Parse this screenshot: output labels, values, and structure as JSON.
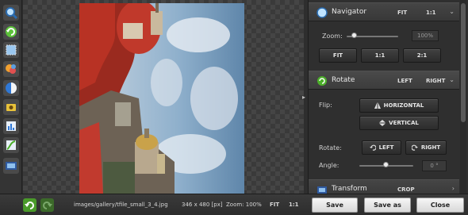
{
  "toolbar": {
    "tools": [
      "zoom-icon",
      "rotate-icon",
      "crop-icon",
      "effects-icon",
      "color-icon",
      "light-icon",
      "levels-icon",
      "curves-icon",
      "resize-icon"
    ]
  },
  "canvas": {
    "image_name": "cathedral-tilted-photo"
  },
  "navigator": {
    "title": "Navigator",
    "fit_label": "FIT",
    "one_to_one_label": "1:1",
    "zoom_label": "Zoom:",
    "zoom_value": "100%",
    "zoom_level": 0.15,
    "buttons": [
      "FIT",
      "1:1",
      "2:1"
    ]
  },
  "rotate": {
    "title": "Rotate",
    "left_label": "LEFT",
    "right_label": "RIGHT",
    "flip_label": "Flip:",
    "flip_horizontal": "HORIZONTAL",
    "flip_vertical": "VERTICAL",
    "rotate_label": "Rotate:",
    "rotate_left": "LEFT",
    "rotate_right": "RIGHT",
    "angle_label": "Angle:",
    "angle_value": "0 °",
    "angle_level": 0.5
  },
  "transform": {
    "title": "Transform",
    "crop_label": "CROP"
  },
  "status": {
    "file_path": "images/gallery/tfile_small_3_4.jpg",
    "dimensions": "346 x 480 [px]",
    "zoom": "Zoom: 100%",
    "fit": "FIT",
    "one_to_one": "1:1"
  },
  "actions": {
    "save": "Save",
    "save_as": "Save as",
    "close": "Close"
  },
  "colors": {
    "accent_green": "#4caf2a",
    "accent_blue": "#3b7fd0",
    "panel_bg": "#2f2f2f"
  }
}
